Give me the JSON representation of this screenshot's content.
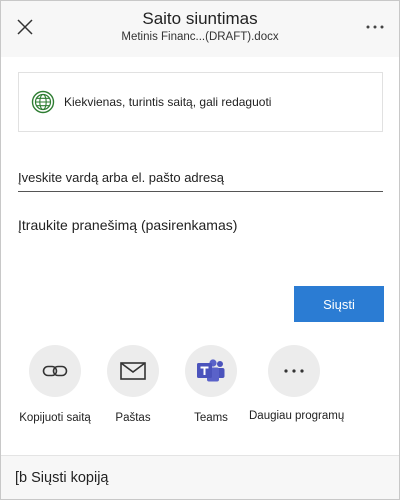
{
  "header": {
    "title": "Saito siuntimas",
    "file_name": "Metinis  Financ...(DRAFT).docx"
  },
  "permission": {
    "text": "Kiekvienas, turintis saitą, gali redaguoti"
  },
  "recipient": {
    "placeholder": "Įveskite vardą arba el. pašto adresą"
  },
  "message": {
    "placeholder": "Įtraukite pranešimą (pasirenkamas)"
  },
  "send_label": "Siųsti",
  "apps": [
    {
      "label": "Kopijuoti saitą",
      "icon": "link-icon"
    },
    {
      "label": "Paštas",
      "icon": "mail-icon"
    },
    {
      "label": "Teams",
      "icon": "teams-icon"
    },
    {
      "label": "Daugiau programų",
      "icon": "more-horizontal-icon"
    }
  ],
  "footer": {
    "label": "[b Siųsti kopiją"
  },
  "colors": {
    "accent": "#2b7cd3",
    "globe": "#2e7d32",
    "teams": "#4b53bc"
  }
}
